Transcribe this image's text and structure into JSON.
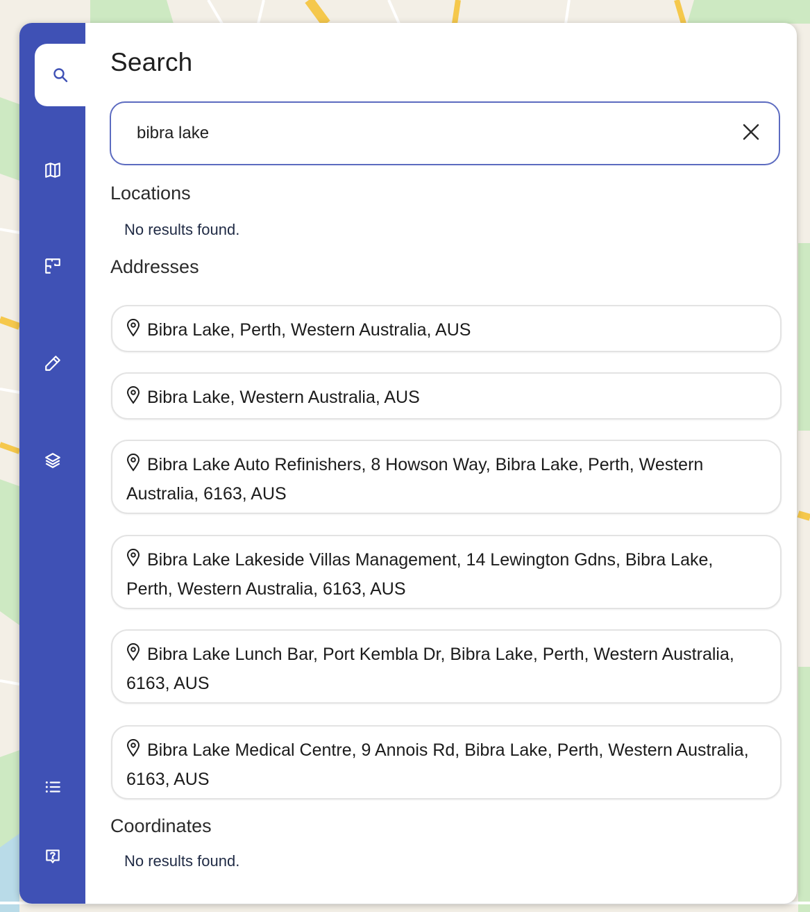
{
  "search": {
    "title": "Search",
    "query": "bibra lake"
  },
  "sections": {
    "locations": {
      "heading": "Locations",
      "empty_text": "No results found."
    },
    "addresses": {
      "heading": "Addresses",
      "items": [
        "Bibra Lake, Perth, Western Australia, AUS",
        "Bibra Lake, Western Australia, AUS",
        "Bibra Lake Auto Refinishers, 8 Howson Way, Bibra Lake, Perth, Western Australia, 6163, AUS",
        "Bibra Lake Lakeside Villas Management, 14 Lewington Gdns, Bibra Lake, Perth, Western Australia, 6163, AUS",
        "Bibra Lake Lunch Bar, Port Kembla Dr, Bibra Lake, Perth, Western Australia, 6163, AUS",
        "Bibra Lake Medical Centre, 9 Annois Rd, Bibra Lake, Perth, Western Australia, 6163, AUS"
      ]
    },
    "coordinates": {
      "heading": "Coordinates",
      "empty_text": "No results found."
    }
  },
  "rail": {
    "items": [
      {
        "icon": "search-icon",
        "active": true
      },
      {
        "icon": "map-icon",
        "active": false
      },
      {
        "icon": "floor-plan-icon",
        "active": false
      },
      {
        "icon": "pencil-icon",
        "active": false
      },
      {
        "icon": "layers-icon",
        "active": false
      },
      {
        "icon": "list-icon",
        "active": false
      },
      {
        "icon": "help-icon",
        "active": false
      }
    ]
  },
  "colors": {
    "rail": "#3f51b5",
    "search_border": "#5c6bc0",
    "map_green": "#cde9c2",
    "map_road": "#f5c84c"
  }
}
